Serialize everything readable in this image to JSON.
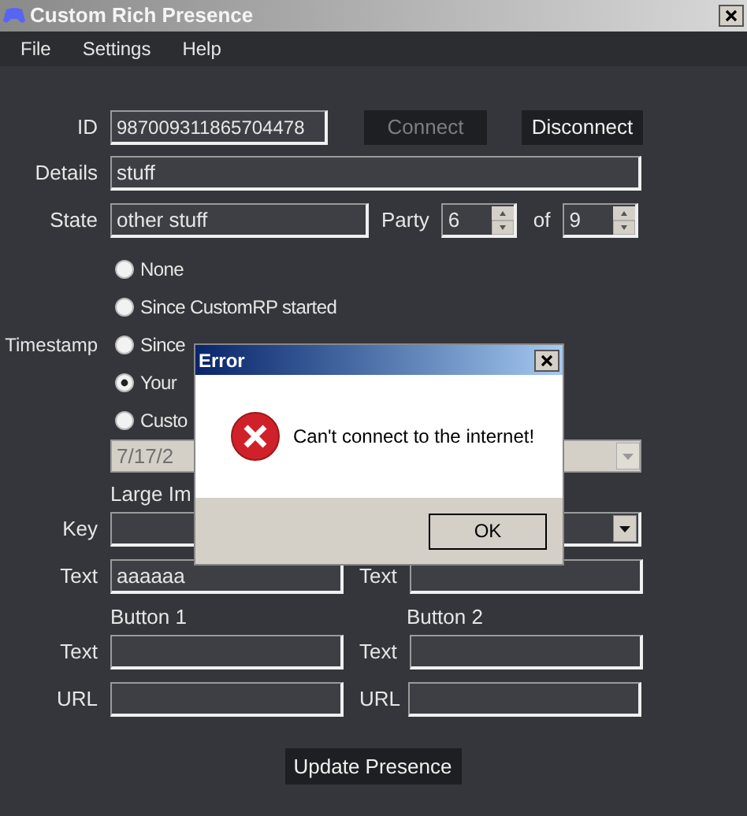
{
  "window": {
    "title": "Custom Rich Presence"
  },
  "menu": [
    {
      "label": "File"
    },
    {
      "label": "Settings"
    },
    {
      "label": "Help"
    }
  ],
  "id": {
    "label": "ID",
    "value": "987009311865704478"
  },
  "connect_button": {
    "label": "Connect",
    "disabled": true
  },
  "disconnect_button": {
    "label": "Disconnect",
    "disabled": false
  },
  "details": {
    "label": "Details",
    "value": "stuff"
  },
  "state": {
    "label": "State",
    "value": "other stuff"
  },
  "party": {
    "label": "Party",
    "value": "6",
    "of_label": "of",
    "max": "9"
  },
  "timestamp": {
    "label": "Timestamp",
    "options": [
      {
        "label": "None",
        "selected": false
      },
      {
        "label": "Since CustomRP started",
        "selected": false
      },
      {
        "label": "Since",
        "selected": false
      },
      {
        "label": "Your",
        "selected": true
      },
      {
        "label": "Custo",
        "selected": false
      }
    ]
  },
  "date": {
    "value": "7/17/2",
    "disabled": true
  },
  "large_image": {
    "heading": "Large Im",
    "key_label": "Key",
    "text_label": "Text",
    "text_value": "aaaaaa"
  },
  "small_image": {
    "text_label": "Text"
  },
  "buttons": [
    {
      "heading": "Button 1",
      "text_label": "Text",
      "url_label": "URL"
    },
    {
      "heading": "Button 2",
      "text_label": "Text",
      "url_label": "URL"
    }
  ],
  "update_button": {
    "label": "Update Presence"
  },
  "dialog": {
    "title": "Error",
    "message": "Can't connect to the internet!",
    "ok": "OK"
  }
}
